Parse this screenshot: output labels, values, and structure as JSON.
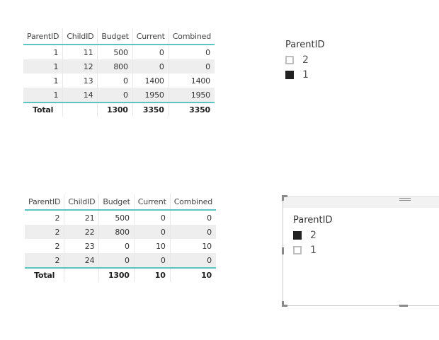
{
  "table1": {
    "headers": [
      "ParentID",
      "ChildID",
      "Budget",
      "Current",
      "Combined"
    ],
    "rows": [
      [
        "1",
        "11",
        "500",
        "0",
        "0"
      ],
      [
        "1",
        "12",
        "800",
        "0",
        "0"
      ],
      [
        "1",
        "13",
        "0",
        "1400",
        "1400"
      ],
      [
        "1",
        "14",
        "0",
        "1950",
        "1950"
      ]
    ],
    "total": {
      "label": "Total",
      "childid": "",
      "budget": "1300",
      "current": "3350",
      "combined": "3350"
    }
  },
  "table2": {
    "headers": [
      "ParentID",
      "ChildID",
      "Budget",
      "Current",
      "Combined"
    ],
    "rows": [
      [
        "2",
        "21",
        "500",
        "0",
        "0"
      ],
      [
        "2",
        "22",
        "800",
        "0",
        "0"
      ],
      [
        "2",
        "23",
        "0",
        "10",
        "10"
      ],
      [
        "2",
        "24",
        "0",
        "0",
        "0"
      ]
    ],
    "total": {
      "label": "Total",
      "childid": "",
      "budget": "1300",
      "current": "10",
      "combined": "10"
    }
  },
  "slicer1": {
    "title": "ParentID",
    "items": [
      {
        "label": "2",
        "checked": false
      },
      {
        "label": "1",
        "checked": true
      }
    ]
  },
  "slicer2": {
    "title": "ParentID",
    "items": [
      {
        "label": "2",
        "checked": true
      },
      {
        "label": "1",
        "checked": false
      }
    ]
  },
  "colors": {
    "accent_teal": "#5cc4c0",
    "row_band": "#eeeeee",
    "checkbox_checked": "#222222",
    "checkbox_unchecked_border": "#bdbdbd"
  }
}
